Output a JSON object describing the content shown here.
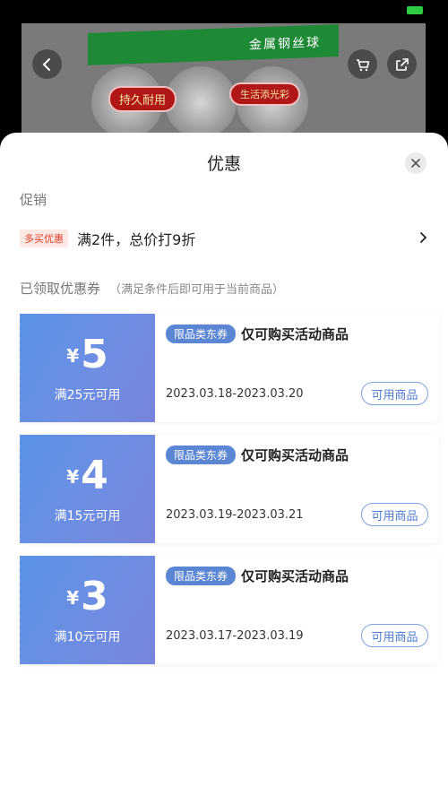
{
  "product_image": {
    "band_text": "金属钢丝球",
    "label_left": "持久耐用",
    "label_right": "生活添光彩"
  },
  "sheet": {
    "title": "优惠",
    "promo_section_label": "促销",
    "promo": {
      "tag": "多买优惠",
      "text": "满2件，总价打9折"
    },
    "coupon_section_label": "已领取优惠券",
    "coupon_section_note": "（满足条件后即可用于当前商品）",
    "coupons": [
      {
        "yen": "¥",
        "amount": "5",
        "condition": "满25元可用",
        "category_tag": "限品类东券",
        "title": "仅可购买活动商品",
        "date_range": "2023.03.18-2023.03.20",
        "button_label": "可用商品"
      },
      {
        "yen": "¥",
        "amount": "4",
        "condition": "满15元可用",
        "category_tag": "限品类东券",
        "title": "仅可购买活动商品",
        "date_range": "2023.03.19-2023.03.21",
        "button_label": "可用商品"
      },
      {
        "yen": "¥",
        "amount": "3",
        "condition": "满10元可用",
        "category_tag": "限品类东券",
        "title": "仅可购买活动商品",
        "date_range": "2023.03.17-2023.03.19",
        "button_label": "可用商品"
      }
    ]
  },
  "icons": {
    "back": "chevron-left-icon",
    "cart": "cart-icon",
    "share": "share-icon",
    "close": "close-icon",
    "promo_arrow": "chevron-right-icon"
  },
  "colors": {
    "accent_blue": "#5a92e6",
    "promo_red": "#e0402c",
    "battery_green": "#2ecc40"
  }
}
